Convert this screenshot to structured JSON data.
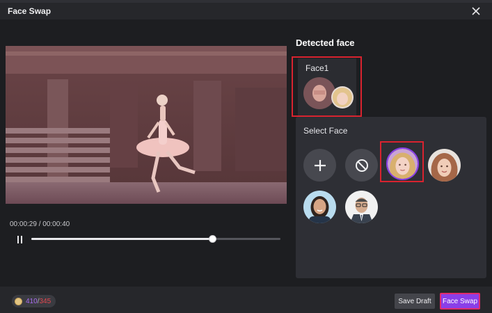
{
  "dialog": {
    "title": "Face Swap"
  },
  "player": {
    "current_time": "00:00:29",
    "separator": " / ",
    "total_time": "00:00:40",
    "progress": 0.725
  },
  "detected": {
    "title": "Detected face",
    "face_label": "Face1"
  },
  "select": {
    "title": "Select Face",
    "options": [
      "add-icon",
      "none-icon",
      "face-young-woman-blonde",
      "face-woman-auburn",
      "face-woman-dark-hair",
      "face-man-glasses"
    ],
    "selected_index": 2
  },
  "footer": {
    "credits_used": "410",
    "credits_sep": "/",
    "credits_total": "345",
    "save_draft": "Save Draft",
    "face_swap": "Face Swap"
  },
  "colors": {
    "accent": "#8a3fe8",
    "highlight": "#d9232f",
    "credit_used": "#a86cf0",
    "credit_total": "#e2474f"
  }
}
